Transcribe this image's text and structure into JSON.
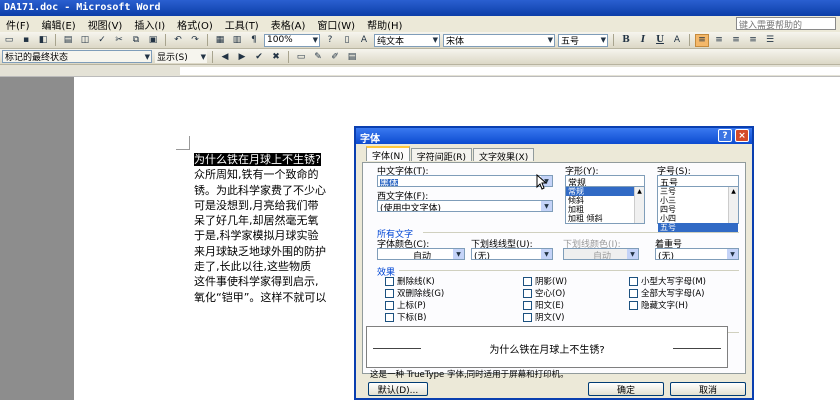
{
  "window": {
    "title": "DA171.doc - Microsoft Word"
  },
  "menu": {
    "items": [
      "件(F)",
      "编辑(E)",
      "视图(V)",
      "插入(I)",
      "格式(O)",
      "工具(T)",
      "表格(A)",
      "窗口(W)",
      "帮助(H)"
    ],
    "help_placeholder": "键入需要帮助的"
  },
  "toolbar": {
    "zoom": "100%",
    "style": "纯文本",
    "font": "宋体",
    "size": "五号",
    "bold": "B",
    "italic": "I",
    "underline": "U",
    "review_state": "标记的最终状态",
    "show": "显示(S)"
  },
  "document": {
    "lines": [
      "为什么铁在月球上不生锈?",
      "众所周知,铁有一个致命的",
      "锈。为此科学家费了不少心",
      "可是没想到,月亮给我们带",
      "呆了好几年,却居然毫无氧",
      "于是,科学家模拟月球实验",
      "来月球缺乏地球外围的防护",
      "走了,长此以往,这些物质",
      "这件事使科学家得到启示,",
      "氧化“铠甲”。这样不就可以"
    ]
  },
  "dialog": {
    "title": "字体",
    "help_btn": "?",
    "close_btn": "×",
    "tabs": [
      "字体(N)",
      "字符间距(R)",
      "文字效果(X)"
    ],
    "cn_font_label": "中文字体(T):",
    "cn_font_value": "黑体",
    "west_font_label": "西文字体(F):",
    "west_font_value": "(使用中文字体)",
    "style_label": "字形(Y):",
    "style_value": "常规",
    "style_options": [
      "常规",
      "倾斜",
      "加粗",
      "加粗 倾斜"
    ],
    "size_label": "字号(S):",
    "size_value": "五号",
    "size_options": [
      "三号",
      "小三",
      "四号",
      "小四",
      "五号"
    ],
    "all_text_title": "所有文字",
    "font_color_label": "字体颜色(C):",
    "font_color_value": "自动",
    "underline_label": "下划线线型(U):",
    "underline_value": "(无)",
    "underline_color_label": "下划线颜色(I):",
    "underline_color_value": "自动",
    "emphasis_label": "着重号",
    "emphasis_value": "(无)",
    "effects_title": "效果",
    "effects": [
      "删除线(K)",
      "阴影(W)",
      "小型大写字母(M)",
      "双删除线(G)",
      "空心(O)",
      "全部大写字母(A)",
      "上标(P)",
      "阳文(E)",
      "隐藏文字(H)",
      "下标(B)",
      "阴文(V)"
    ],
    "preview_title": "预览",
    "preview_text": "为什么铁在月球上不生锈?",
    "note": "这是一种 TrueType 字体,同时适用于屏幕和打印机。",
    "default_btn": "默认(D)...",
    "ok_btn": "确定",
    "cancel_btn": "取消"
  }
}
